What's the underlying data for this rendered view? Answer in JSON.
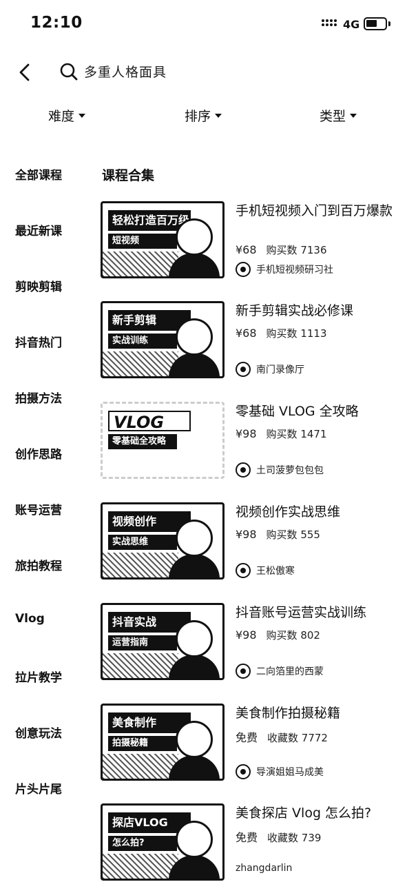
{
  "status": {
    "time": "12:10",
    "network": "4G"
  },
  "search": {
    "query": "多重人格面具"
  },
  "filters": [
    {
      "label": "难度"
    },
    {
      "label": "排序"
    },
    {
      "label": "类型"
    }
  ],
  "sidebar": {
    "items": [
      {
        "label": "全部课程"
      },
      {
        "label": "最近新课"
      },
      {
        "label": "剪映剪辑"
      },
      {
        "label": "抖音热门"
      },
      {
        "label": "拍摄方法"
      },
      {
        "label": "创作思路"
      },
      {
        "label": "账号运营"
      },
      {
        "label": "旅拍教程"
      },
      {
        "label": "Vlog"
      },
      {
        "label": "拉片教学"
      },
      {
        "label": "创意玩法"
      },
      {
        "label": "片头片尾"
      }
    ]
  },
  "main": {
    "section_title": "课程合集",
    "courses": [
      {
        "title": "手机短视频入门到百万爆款",
        "price": "¥68",
        "stat": "购买数 7136",
        "author": "手机短视频研习社",
        "thumb_line1": "轻松打造百万级",
        "thumb_line2": "短视频"
      },
      {
        "title": "新手剪辑实战必修课",
        "price": "¥68",
        "stat": "购买数 1113",
        "author": "南门录像厅",
        "thumb_line1": "新手剪辑",
        "thumb_line2": "实战训练"
      },
      {
        "title": "零基础 VLOG 全攻略",
        "price": "¥98",
        "stat": "购买数 1471",
        "author": "土司菠萝包包包",
        "thumb_line1": "VLOG",
        "thumb_line2": "零基础全攻略"
      },
      {
        "title": "视频创作实战思维",
        "price": "¥98",
        "stat": "购买数 555",
        "author": "王松傲寒",
        "thumb_line1": "视频创作",
        "thumb_line2": "实战思维"
      },
      {
        "title": "抖音账号运营实战训练",
        "price": "¥98",
        "stat": "购买数 802",
        "author": "二向箔里的西蒙",
        "thumb_line1": "抖音实战",
        "thumb_line2": "运营指南"
      },
      {
        "title": "美食制作拍摄秘籍",
        "price": "免费",
        "stat": "收藏数 7772",
        "author": "导演姐姐马成美",
        "thumb_line1": "美食制作",
        "thumb_line2": "拍摄秘籍"
      },
      {
        "title": "美食探店 Vlog 怎么拍?",
        "price": "免费",
        "stat": "收藏数 739",
        "author": "zhangdarlin",
        "thumb_line1": "探店VLOG",
        "thumb_line2": "怎么拍?"
      }
    ]
  }
}
